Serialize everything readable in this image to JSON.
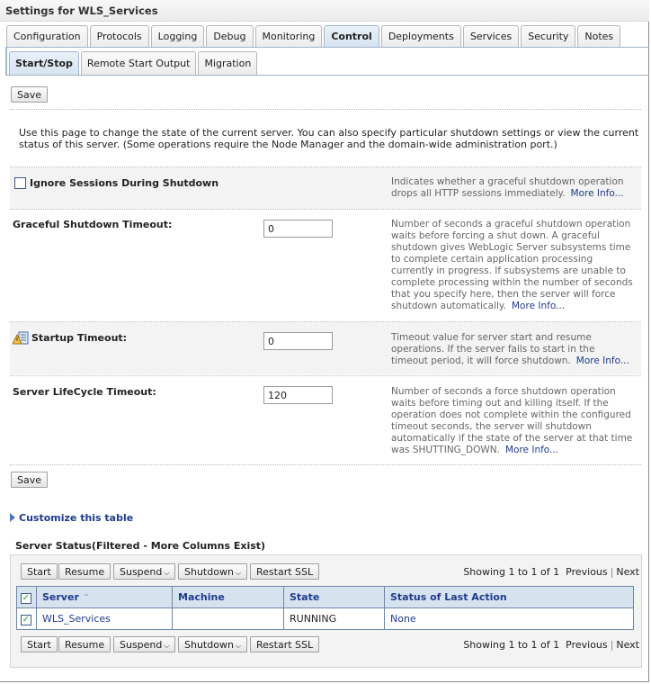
{
  "window": {
    "title": "Settings for WLS_Services"
  },
  "tabs": [
    {
      "label": "Configuration",
      "active": false
    },
    {
      "label": "Protocols",
      "active": false
    },
    {
      "label": "Logging",
      "active": false
    },
    {
      "label": "Debug",
      "active": false
    },
    {
      "label": "Monitoring",
      "active": false
    },
    {
      "label": "Control",
      "active": true
    },
    {
      "label": "Deployments",
      "active": false
    },
    {
      "label": "Services",
      "active": false
    },
    {
      "label": "Security",
      "active": false
    },
    {
      "label": "Notes",
      "active": false
    }
  ],
  "subtabs": [
    {
      "label": "Start/Stop",
      "active": true
    },
    {
      "label": "Remote Start Output",
      "active": false
    },
    {
      "label": "Migration",
      "active": false
    }
  ],
  "save_label": "Save",
  "intro": "Use this page to change the state of the current server. You can also specify particular shutdown settings or view the current status of this server. (Some operations require the Node Manager and the domain-wide administration port.)",
  "more_info": "More Info...",
  "fields": {
    "ignore_sessions": {
      "label": "Ignore Sessions During Shutdown",
      "checked": false,
      "help": "Indicates whether a graceful shutdown operation drops all HTTP sessions immediately."
    },
    "graceful_timeout": {
      "label": "Graceful Shutdown Timeout:",
      "value": "0",
      "help": "Number of seconds a graceful shutdown operation waits before forcing a shut down. A graceful shutdown gives WebLogic Server subsystems time to complete certain application processing currently in progress. If subsystems are unable to complete processing within the number of seconds that you specify here, then the server will force shutdown automatically."
    },
    "startup_timeout": {
      "label": "Startup Timeout:",
      "value": "0",
      "icon": "warning-restart-icon",
      "help": "Timeout value for server start and resume operations. If the server fails to start in the timeout period, it will force shutdown."
    },
    "lifecycle_timeout": {
      "label": "Server LifeCycle Timeout:",
      "value": "120",
      "help": "Number of seconds a force shutdown operation waits before timing out and killing itself. If the operation does not complete within the configured timeout seconds, the server will shutdown automatically if the state of the server at that time was SHUTTING_DOWN."
    }
  },
  "customize_label": "Customize this table",
  "server_status": {
    "title": "Server Status(Filtered - More Columns Exist)",
    "actions": [
      "Start",
      "Resume",
      "Suspend",
      "Shutdown",
      "Restart SSL"
    ],
    "dropdown_actions": [
      "Suspend",
      "Shutdown"
    ],
    "pager": {
      "text": "Showing 1 to 1 of 1",
      "previous": "Previous",
      "next": "Next"
    },
    "columns": [
      "Server",
      "Machine",
      "State",
      "Status of Last Action"
    ],
    "sort_icon": "sort-ascending-icon",
    "rows": [
      {
        "selected": true,
        "server": "WLS_Services",
        "machine": "",
        "state": "RUNNING",
        "last_action": "None"
      }
    ],
    "select_all": true
  }
}
